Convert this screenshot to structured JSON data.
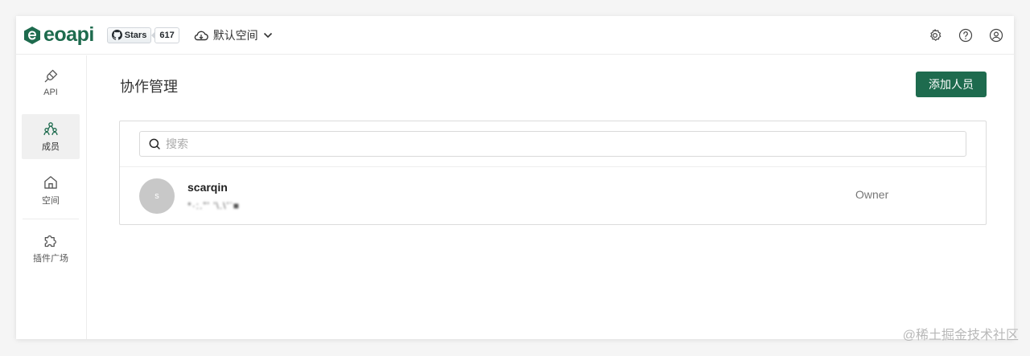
{
  "header": {
    "logo_text": "eoapi",
    "github": {
      "label": "Stars",
      "count": "617"
    },
    "workspace": "默认空间",
    "icons": [
      "gear-icon",
      "help-icon",
      "user-icon"
    ]
  },
  "sidebar": {
    "items": [
      {
        "label": "API",
        "icon": "plug-icon",
        "active": false
      },
      {
        "label": "成员",
        "icon": "members-icon",
        "active": true
      },
      {
        "label": "空间",
        "icon": "home-icon",
        "active": false
      },
      {
        "label": "插件广场",
        "icon": "puzzle-icon",
        "active": false
      }
    ]
  },
  "main": {
    "title": "协作管理",
    "add_button": "添加人员",
    "search": {
      "placeholder": "搜索",
      "value": ""
    },
    "members": [
      {
        "avatar": "s",
        "name": "scarqin",
        "email": "*·:.\"' '\\.\\'¨■",
        "role": "Owner"
      }
    ]
  },
  "colors": {
    "brand": "#1e6b4e"
  },
  "watermark": "@稀土掘金技术社区"
}
